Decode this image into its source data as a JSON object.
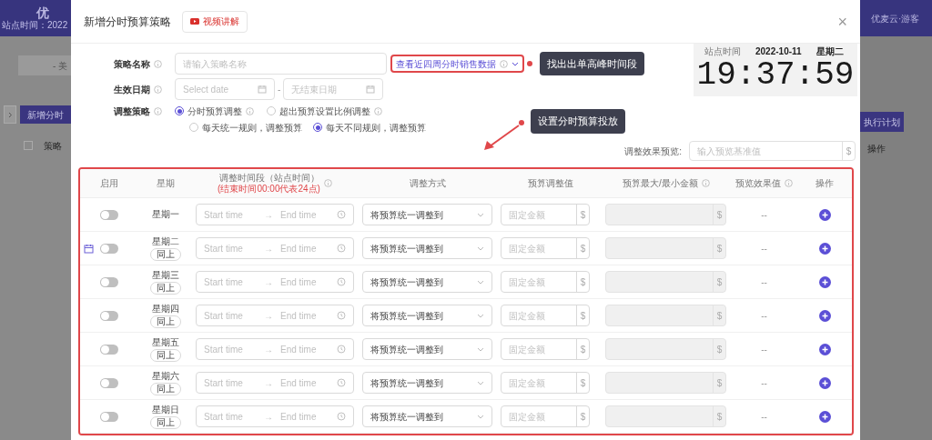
{
  "background": {
    "left": {
      "logo": "优",
      "header_note": "站点时间：2022",
      "select": "- 美",
      "button": "新增分时",
      "column": "策略",
      "checked": false
    },
    "right": {
      "user": "优麦云·游客",
      "button": "执行计划",
      "column": "操作"
    }
  },
  "dialog": {
    "title": "新增分时预算策略",
    "video_button": "视频讲解",
    "close": "×"
  },
  "form": {
    "name": {
      "label": "策略名称",
      "placeholder": "请输入策略名称",
      "link": "查看近四周分时销售数据"
    },
    "date": {
      "label": "生效日期",
      "start_placeholder": "Select date",
      "separator": "-",
      "end_placeholder": "无结束日期"
    },
    "strategy": {
      "label": "调整策略",
      "modes": [
        {
          "label": "分时预算调整",
          "selected": true
        },
        {
          "label": "超出预算设置比例调整",
          "selected": false
        }
      ],
      "rules": [
        {
          "label": "每天统一规则，调整预算",
          "selected": false
        },
        {
          "label": "每天不同规则，调整预算",
          "selected": true
        }
      ]
    },
    "preview": {
      "label": "调整效果预览:",
      "placeholder": "输入预览基准值",
      "unit": "$"
    }
  },
  "callouts": [
    {
      "text": "找出出单高峰时间段"
    },
    {
      "text": "设置分时预算投放"
    }
  ],
  "clock": {
    "label": "站点时间",
    "date": "2022-10-11",
    "weekday": "星期二",
    "time": "19:37:59"
  },
  "table": {
    "columns": [
      {
        "label": "启用",
        "info": false
      },
      {
        "label": "星期",
        "info": false
      },
      {
        "label": "调整时间段（站点时间）",
        "note": "(结束时间00:00代表24点)",
        "info": true
      },
      {
        "label": "调整方式",
        "info": false
      },
      {
        "label": "预算调整值",
        "info": false
      },
      {
        "label": "预算最大/最小金额",
        "info": true
      },
      {
        "label": "预览效果值",
        "info": true
      },
      {
        "label": "操作",
        "info": false
      }
    ],
    "rows": [
      {
        "day": "星期一",
        "enabled": false,
        "calendar_marker": false,
        "start_placeholder": "Start time",
        "arrow": "→",
        "end_placeholder": "End time",
        "method": "将预算统一调整到",
        "amount_placeholder": "固定金额",
        "unit": "$",
        "limit_unit": "$",
        "preview": "--"
      },
      {
        "day": "星期二",
        "copy_label": "同上",
        "enabled": false,
        "calendar_marker": true,
        "start_placeholder": "Start time",
        "arrow": "→",
        "end_placeholder": "End time",
        "method": "将预算统一调整到",
        "amount_placeholder": "固定金额",
        "unit": "$",
        "limit_unit": "$",
        "preview": "--"
      },
      {
        "day": "星期三",
        "copy_label": "同上",
        "enabled": false,
        "calendar_marker": false,
        "start_placeholder": "Start time",
        "arrow": "→",
        "end_placeholder": "End time",
        "method": "将预算统一调整到",
        "amount_placeholder": "固定金额",
        "unit": "$",
        "limit_unit": "$",
        "preview": "--"
      },
      {
        "day": "星期四",
        "copy_label": "同上",
        "enabled": false,
        "calendar_marker": false,
        "start_placeholder": "Start time",
        "arrow": "→",
        "end_placeholder": "End time",
        "method": "将预算统一调整到",
        "amount_placeholder": "固定金额",
        "unit": "$",
        "limit_unit": "$",
        "preview": "--"
      },
      {
        "day": "星期五",
        "copy_label": "同上",
        "enabled": false,
        "calendar_marker": false,
        "start_placeholder": "Start time",
        "arrow": "→",
        "end_placeholder": "End time",
        "method": "将预算统一调整到",
        "amount_placeholder": "固定金额",
        "unit": "$",
        "limit_unit": "$",
        "preview": "--"
      },
      {
        "day": "星期六",
        "copy_label": "同上",
        "enabled": false,
        "calendar_marker": false,
        "start_placeholder": "Start time",
        "arrow": "→",
        "end_placeholder": "End time",
        "method": "将预算统一调整到",
        "amount_placeholder": "固定金额",
        "unit": "$",
        "limit_unit": "$",
        "preview": "--"
      },
      {
        "day": "星期日",
        "copy_label": "同上",
        "enabled": false,
        "calendar_marker": false,
        "start_placeholder": "Start time",
        "arrow": "→",
        "end_placeholder": "End time",
        "method": "将预算统一调整到",
        "amount_placeholder": "固定金额",
        "unit": "$",
        "limit_unit": "$",
        "preview": "--"
      }
    ]
  }
}
